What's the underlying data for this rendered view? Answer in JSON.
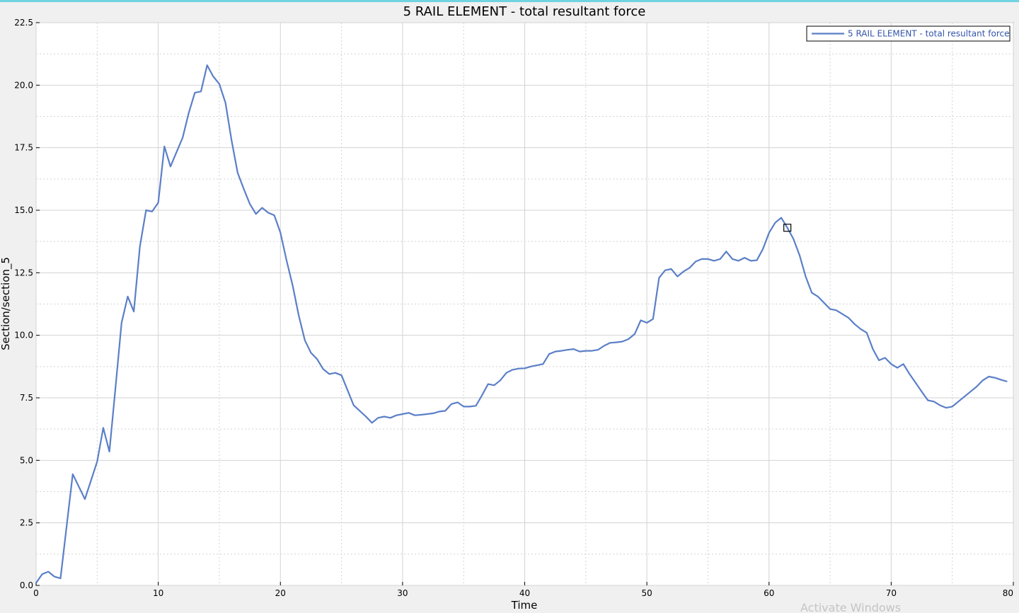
{
  "colors": {
    "line": "#5b7fc7",
    "background": "#f0f0f0",
    "plot_bg": "#ffffff",
    "grid": "#d3d3d3",
    "accent": "#6fd3e0"
  },
  "watermark": "Activate Windows",
  "chart_data": {
    "type": "line",
    "title": "5 RAIL ELEMENT - total resultant force",
    "xlabel": "Time",
    "ylabel": "Section/section_5",
    "xlim": [
      0,
      80
    ],
    "ylim": [
      0,
      22.5
    ],
    "xticks": [
      "0",
      "10",
      "20",
      "30",
      "40",
      "50",
      "60",
      "70",
      "80"
    ],
    "yticks": [
      "0.0",
      "2.5",
      "5.0",
      "7.5",
      "10.0",
      "12.5",
      "15.0",
      "17.5",
      "20.0",
      "22.5"
    ],
    "grid": true,
    "legend_position": "top-right",
    "series": [
      {
        "name": "5 RAIL ELEMENT - total resultant force",
        "x": [
          0,
          0.5,
          1,
          1.5,
          2,
          3,
          4,
          5,
          5.5,
          6,
          6.5,
          7,
          7.5,
          8,
          8.5,
          9,
          9.5,
          10,
          10.5,
          11,
          12,
          12.5,
          13,
          13.5,
          14,
          14.5,
          15,
          15.5,
          16,
          16.5,
          17,
          17.5,
          18,
          18.5,
          19,
          19.5,
          20,
          20.5,
          21,
          21.5,
          22,
          22.5,
          23,
          23.5,
          24,
          24.5,
          25,
          26,
          27,
          27.5,
          28,
          28.5,
          29,
          29.5,
          30,
          30.5,
          31,
          31.5,
          32,
          32.5,
          33,
          33.5,
          34,
          34.5,
          35,
          35.5,
          36,
          36.5,
          37,
          37.5,
          38,
          38.5,
          39,
          39.5,
          40,
          40.5,
          41,
          41.5,
          42,
          42.5,
          43,
          43.5,
          44,
          44.5,
          45,
          45.5,
          46,
          46.5,
          47,
          47.5,
          48,
          48.5,
          49,
          49.5,
          50,
          50.5,
          51,
          51.5,
          52,
          52.5,
          53,
          53.5,
          54,
          54.5,
          55,
          55.5,
          56,
          56.5,
          57,
          57.5,
          58,
          58.5,
          59,
          59.5,
          60,
          60.5,
          61,
          61.5,
          62,
          62.5,
          63,
          63.5,
          64,
          64.5,
          65,
          65.5,
          66,
          66.5,
          67,
          67.5,
          68,
          68.5,
          69,
          69.5,
          70,
          70.5,
          71,
          71.5,
          72,
          72.5,
          73,
          73.5,
          74,
          74.5,
          75,
          75.5,
          76,
          76.5,
          77,
          77.5,
          78,
          78.5,
          79,
          79.5
        ],
        "y": [
          0.1,
          0.45,
          0.55,
          0.35,
          0.28,
          4.45,
          3.45,
          4.95,
          6.3,
          5.35,
          7.9,
          10.5,
          11.55,
          10.95,
          13.55,
          15.0,
          14.95,
          15.3,
          17.55,
          16.75,
          17.9,
          18.9,
          19.7,
          19.75,
          20.8,
          20.35,
          20.05,
          19.3,
          17.8,
          16.5,
          15.85,
          15.25,
          14.85,
          15.1,
          14.9,
          14.8,
          14.1,
          13.0,
          12.0,
          10.8,
          9.8,
          9.3,
          9.05,
          8.65,
          8.45,
          8.5,
          8.4,
          7.2,
          6.75,
          6.5,
          6.7,
          6.75,
          6.7,
          6.8,
          6.85,
          6.9,
          6.8,
          6.82,
          6.85,
          6.88,
          6.95,
          6.98,
          7.25,
          7.32,
          7.15,
          7.15,
          7.18,
          7.6,
          8.05,
          8.0,
          8.2,
          8.5,
          8.62,
          8.67,
          8.68,
          8.75,
          8.8,
          8.85,
          9.25,
          9.35,
          9.38,
          9.42,
          9.45,
          9.35,
          9.38,
          9.38,
          9.42,
          9.58,
          9.7,
          9.72,
          9.75,
          9.85,
          10.05,
          10.6,
          10.5,
          10.65,
          12.3,
          12.6,
          12.65,
          12.35,
          12.55,
          12.7,
          12.95,
          13.05,
          13.05,
          12.98,
          13.05,
          13.35,
          13.05,
          12.98,
          13.1,
          12.98,
          13.0,
          13.45,
          14.1,
          14.5,
          14.7,
          14.3,
          13.85,
          13.2,
          12.35,
          11.7,
          11.55,
          11.3,
          11.05,
          11.0,
          10.85,
          10.7,
          10.45,
          10.25,
          10.1,
          9.45,
          9.0,
          9.1,
          8.85,
          8.7,
          8.85,
          8.45,
          8.1,
          7.75,
          7.4,
          7.35,
          7.2,
          7.1,
          7.15,
          7.35,
          7.55,
          7.75,
          7.95,
          8.2,
          8.35,
          8.3,
          8.22,
          8.15
        ]
      }
    ],
    "markers": [
      {
        "x": 61.5,
        "y": 14.3,
        "shape": "square"
      }
    ]
  }
}
